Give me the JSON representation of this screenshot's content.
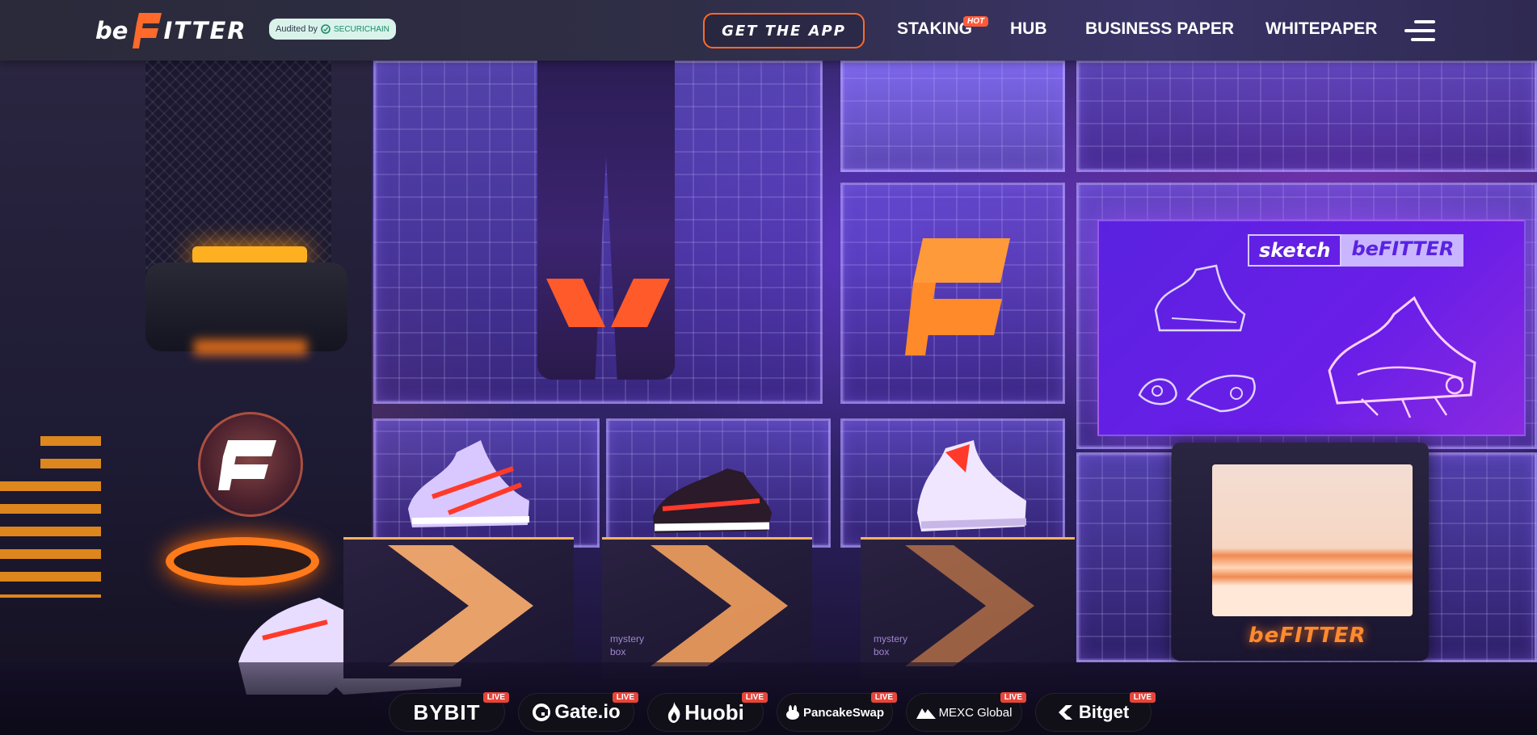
{
  "header": {
    "logo_be": "be",
    "logo_itter": "ITTER",
    "audit": {
      "prefix": "Audited by",
      "brand": "SECURICHAIN"
    },
    "get_app": "GET THE APP",
    "nav": [
      {
        "label": "STAKING",
        "badge": "HOT"
      },
      {
        "label": "HUB"
      },
      {
        "label": "BUSINESS PAPER"
      },
      {
        "label": "WHITEPAPER"
      }
    ],
    "menu_icon": "hamburger-menu-icon"
  },
  "hero": {
    "poster": {
      "left": "sketch",
      "right": "beFITTER"
    },
    "box_labels": [
      {
        "line1": "mystery",
        "line2": "box"
      },
      {
        "line1": "mystery",
        "line2": "box"
      }
    ],
    "tv_logo": "beFITTER"
  },
  "exchanges": [
    {
      "name": "BYBIT",
      "icon": "",
      "badge": "LIVE"
    },
    {
      "name": "Gate.io",
      "icon": "gate-icon",
      "badge": "LIVE"
    },
    {
      "name": "Huobi",
      "icon": "flame-icon",
      "badge": "LIVE"
    },
    {
      "name": "PancakeSwap",
      "icon": "bunny-icon",
      "badge": "LIVE"
    },
    {
      "name": "MEXC Global",
      "icon": "mountain-icon",
      "badge": "LIVE"
    },
    {
      "name": "Bitget",
      "icon": "bitget-icon",
      "badge": "LIVE"
    }
  ],
  "colors": {
    "brand_orange": "#ff6a2a",
    "accent_purple": "#6a1ee8",
    "live_red": "#e8453a",
    "hot_red": "#ff5a3a"
  }
}
